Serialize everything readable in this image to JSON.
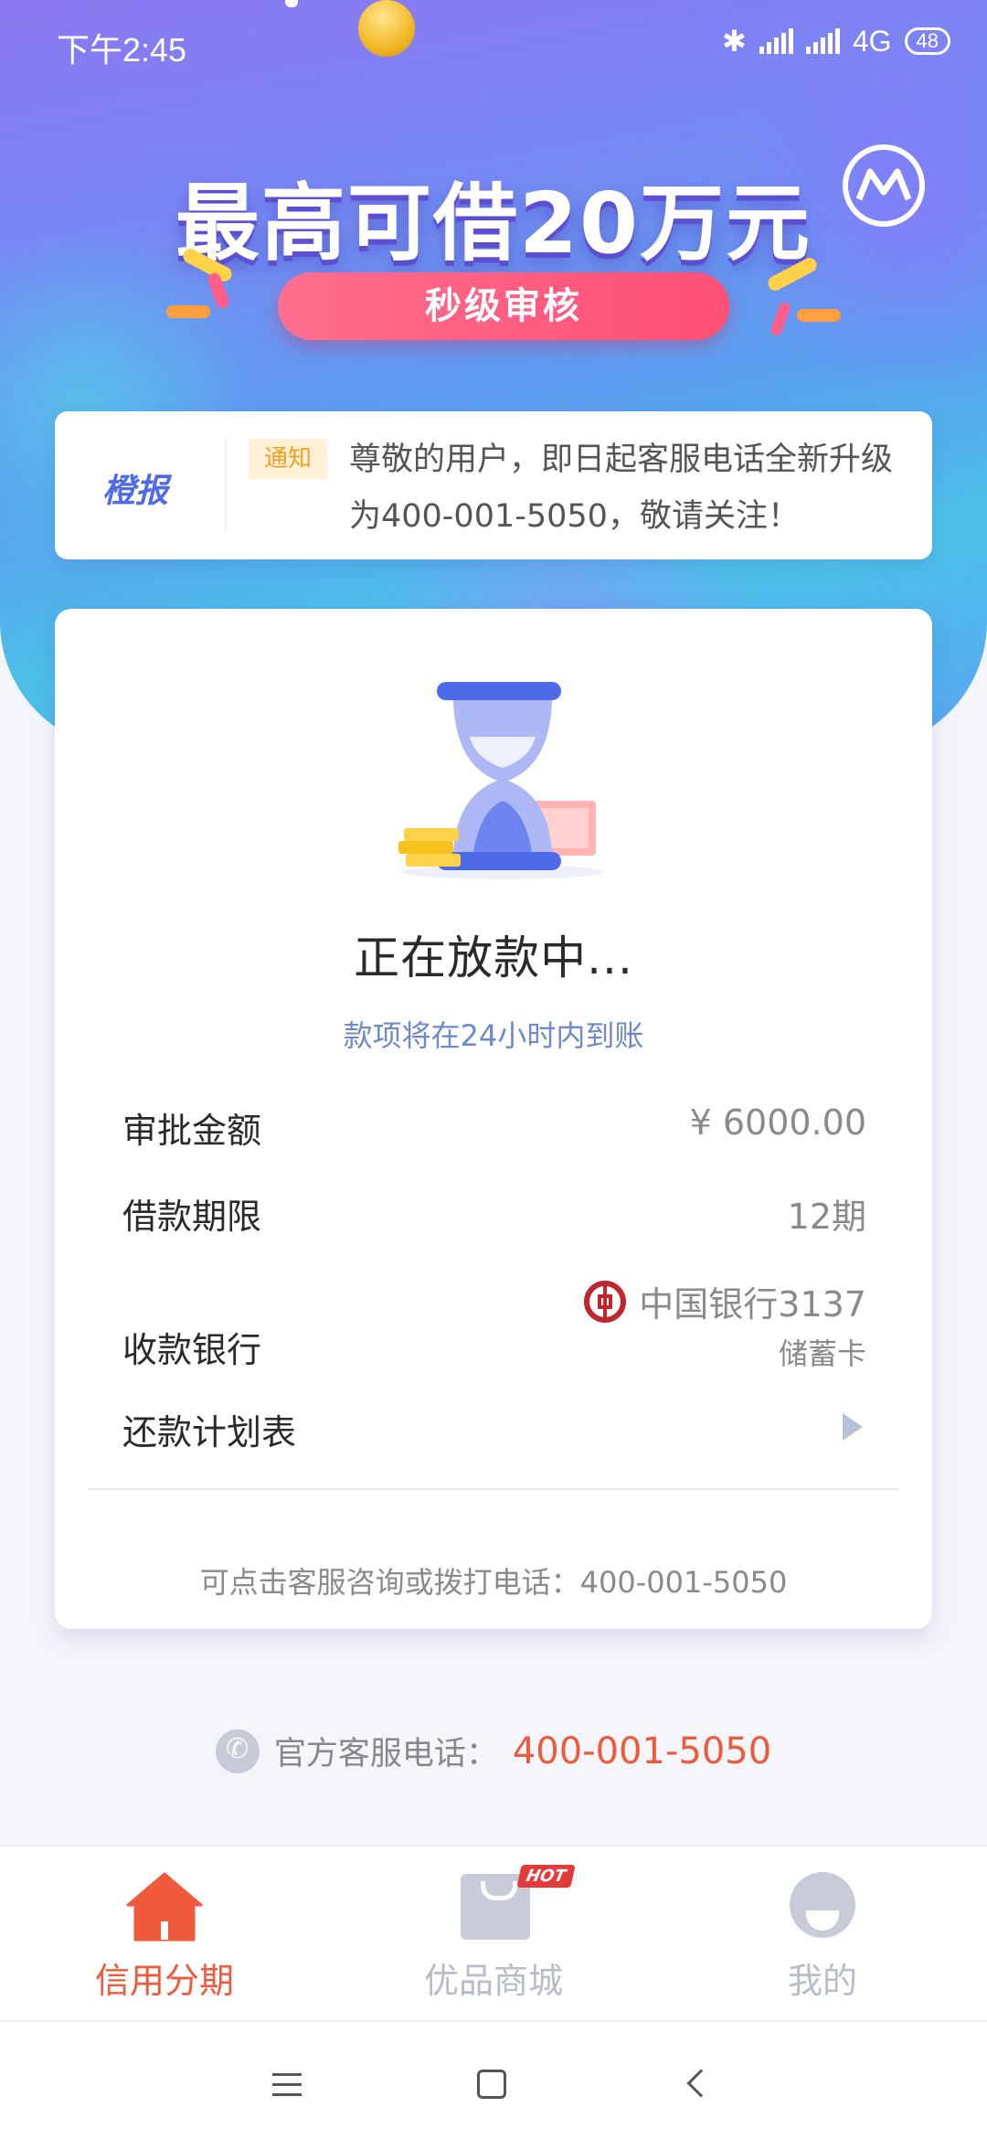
{
  "status_bar": {
    "time": "下午2:45",
    "network": "4G",
    "battery": "48"
  },
  "hero": {
    "headline": "最高可借20万元",
    "pill": "秒级审核"
  },
  "notice": {
    "brand": "橙报",
    "tag": "通知",
    "text": "尊敬的用户，即日起客服电话全新升级为400-001-5050，敬请关注！"
  },
  "loan_status": {
    "title": "正在放款中...",
    "subtitle": "款项将在24小时内到账",
    "rows": [
      {
        "label": "审批金额",
        "value": "¥ 6000.00"
      },
      {
        "label": "借款期限",
        "value": "12期"
      },
      {
        "label": "收款银行",
        "value": "中国银行3137",
        "sub": "储蓄卡"
      },
      {
        "label": "还款计划表"
      }
    ],
    "footer": "可点击客服咨询或拨打电话：400-001-5050"
  },
  "hotline": {
    "label": "官方客服电话：",
    "number": "400-001-5050"
  },
  "tabbar": {
    "tabs": [
      {
        "label": "信用分期",
        "active": true
      },
      {
        "label": "优品商城",
        "badge": "HOT"
      },
      {
        "label": "我的"
      }
    ]
  },
  "colors": {
    "accent": "#ee5a3c",
    "inactive": "#b8bcc8",
    "link_blue": "#6c89c8",
    "pill": "#ff5a7e"
  }
}
